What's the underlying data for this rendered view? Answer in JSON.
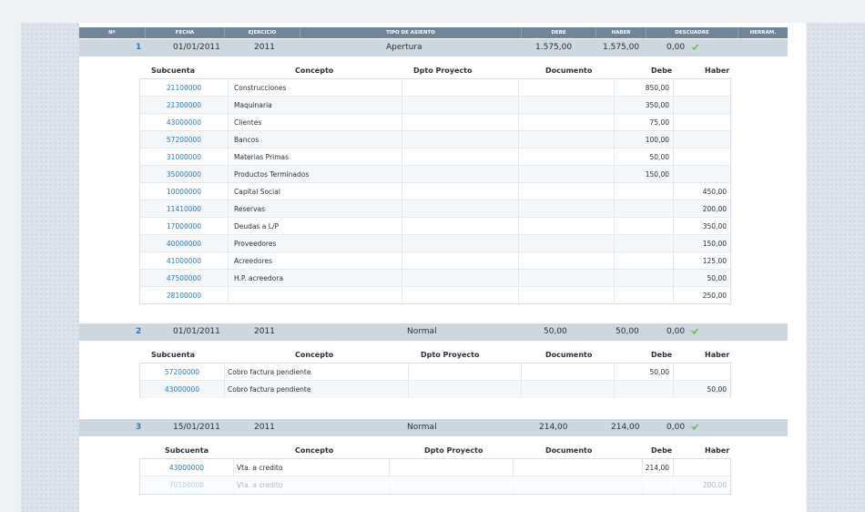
{
  "header": {
    "n": "Nº",
    "fecha": "FECHA",
    "ejercicio": "EJERCICIO",
    "tipo": "TIPO DE ASIENTO",
    "debe": "DEBE",
    "haber": "HABER",
    "descuadre": "DESCUADRE",
    "herram": "HERRAM."
  },
  "sub_headers": {
    "subcuenta": "Subcuenta",
    "concepto": "Concepto",
    "dpto": "Dpto Proyecto",
    "documento": "Documento",
    "debe": "Debe",
    "haber": "Haber"
  },
  "entries": [
    {
      "num": "1",
      "fecha": "01/01/2011",
      "ejercicio": "2011",
      "tipo": "Apertura",
      "debe": "1.575,00",
      "haber": "1.575,00",
      "descuadre": "0,00",
      "rows": [
        {
          "subcuenta": "21100000",
          "concepto": "Construcciones",
          "debe": "850,00",
          "haber": ""
        },
        {
          "subcuenta": "21300000",
          "concepto": "Maquinaria",
          "debe": "350,00",
          "haber": ""
        },
        {
          "subcuenta": "43000000",
          "concepto": "Clientes",
          "debe": "75,00",
          "haber": ""
        },
        {
          "subcuenta": "57200000",
          "concepto": "Bancos",
          "debe": "100,00",
          "haber": ""
        },
        {
          "subcuenta": "31000000",
          "concepto": "Materias Primas",
          "debe": "50,00",
          "haber": ""
        },
        {
          "subcuenta": "35000000",
          "concepto": "Productos Terminados",
          "debe": "150,00",
          "haber": ""
        },
        {
          "subcuenta": "10000000",
          "concepto": "Capital Social",
          "debe": "",
          "haber": "450,00"
        },
        {
          "subcuenta": "11410000",
          "concepto": "Reservas",
          "debe": "",
          "haber": "200,00"
        },
        {
          "subcuenta": "17000000",
          "concepto": "Deudas a L/P",
          "debe": "",
          "haber": "350,00"
        },
        {
          "subcuenta": "40000000",
          "concepto": "Proveedores",
          "debe": "",
          "haber": "150,00"
        },
        {
          "subcuenta": "41000000",
          "concepto": "Acreedores",
          "debe": "",
          "haber": "125,00"
        },
        {
          "subcuenta": "47500000",
          "concepto": "H.P. acreedora",
          "debe": "",
          "haber": "50,00"
        },
        {
          "subcuenta": "28100000",
          "concepto": "",
          "debe": "",
          "haber": "250,00"
        }
      ]
    },
    {
      "num": "2",
      "fecha": "01/01/2011",
      "ejercicio": "2011",
      "tipo": "Normal",
      "debe": "50,00",
      "haber": "50,00",
      "descuadre": "0,00",
      "rows": [
        {
          "subcuenta": "57200000",
          "concepto": "Cobro factura pendiente",
          "debe": "50,00",
          "haber": ""
        },
        {
          "subcuenta": "43000000",
          "concepto": "Cobro factura pendiente",
          "debe": "",
          "haber": "50,00"
        }
      ]
    },
    {
      "num": "3",
      "fecha": "15/01/2011",
      "ejercicio": "2011",
      "tipo": "Normal",
      "debe": "214,00",
      "haber": "214,00",
      "descuadre": "0,00",
      "rows": [
        {
          "subcuenta": "43000000",
          "concepto": "Vta. a credito",
          "debe": "214,00",
          "haber": ""
        },
        {
          "subcuenta": "70100000",
          "concepto": "Vta. a credito",
          "debe": "",
          "haber": "200,00"
        }
      ]
    }
  ],
  "colors": {
    "header": "#6f8599",
    "entry": "#cdd7e0",
    "link": "#2a79b8",
    "check": "#6cbf3a"
  }
}
